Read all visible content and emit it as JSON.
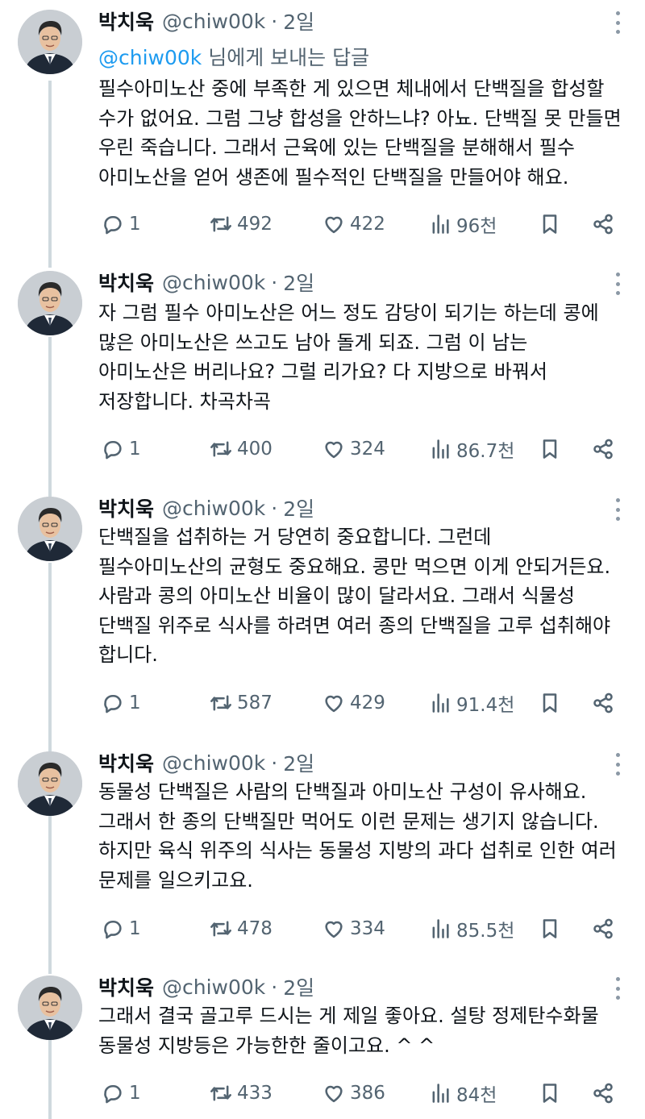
{
  "author": {
    "name": "박치욱",
    "handle": "@chiw00k",
    "separator": "·",
    "time": "2일"
  },
  "reply_to": {
    "mention": "@chiw00k",
    "suffix": " 님에게 보내는 답글"
  },
  "tweets": [
    {
      "lines": [
        "필수아미노산 중에 부족한 게 있으면 체내에서 단백질을 합성할",
        "수가 없어요. 그럼 그냥 합성을 안하느냐? 아뇨. 단백질 못 만들면",
        "우린 죽습니다. 그래서 근육에 있는 단백질을 분해해서 필수",
        "아미노산을 얻어 생존에 필수적인 단백질을 만들어야 해요."
      ],
      "replies": "1",
      "reposts": "492",
      "likes": "422",
      "views": "96천"
    },
    {
      "lines": [
        "자 그럼 필수 아미노산은 어느 정도 감당이 되기는 하는데 콩에",
        "많은 아미노산은 쓰고도 남아 돌게 되죠. 그럼 이 남는",
        "아미노산은 버리나요? 그럴 리가요? 다 지방으로 바꿔서",
        "저장합니다. 차곡차곡"
      ],
      "replies": "1",
      "reposts": "400",
      "likes": "324",
      "views": "86.7천"
    },
    {
      "lines": [
        "단백질을 섭취하는 거 당연히 중요합니다. 그런데",
        "필수아미노산의 균형도 중요해요. 콩만 먹으면 이게 안되거든요.",
        "사람과 콩의 아미노산 비율이 많이 달라서요. 그래서 식물성",
        "단백질 위주로 식사를 하려면 여러 종의 단백질을 고루 섭취해야",
        "합니다."
      ],
      "replies": "1",
      "reposts": "587",
      "likes": "429",
      "views": "91.4천"
    },
    {
      "lines": [
        "동물성 단백질은 사람의 단백질과 아미노산 구성이 유사해요.",
        "그래서 한 종의 단백질만 먹어도 이런 문제는 생기지 않습니다.",
        "하지만 육식 위주의 식사는 동물성 지방의 과다 섭취로 인한 여러",
        "문제를 일으키고요."
      ],
      "replies": "1",
      "reposts": "478",
      "likes": "334",
      "views": "85.5천"
    },
    {
      "lines": [
        "그래서 결국 골고루 드시는 게 제일 좋아요. 설탕 정제탄수화물",
        "동물성 지방등은 가능한한 줄이고요. ^ ^"
      ],
      "replies": "1",
      "reposts": "433",
      "likes": "386",
      "views": "84천"
    }
  ],
  "icons": {
    "reply": "speech-bubble-icon",
    "repost": "repost-arrows-icon",
    "like": "heart-icon",
    "views": "bar-chart-icon",
    "bookmark": "bookmark-icon",
    "share": "share-icon",
    "more": "more-vertical-icon"
  },
  "colors": {
    "text": "#0f1419",
    "secondary": "#536471",
    "mention": "#1d9bf0",
    "thread_line": "#cfd9de"
  }
}
